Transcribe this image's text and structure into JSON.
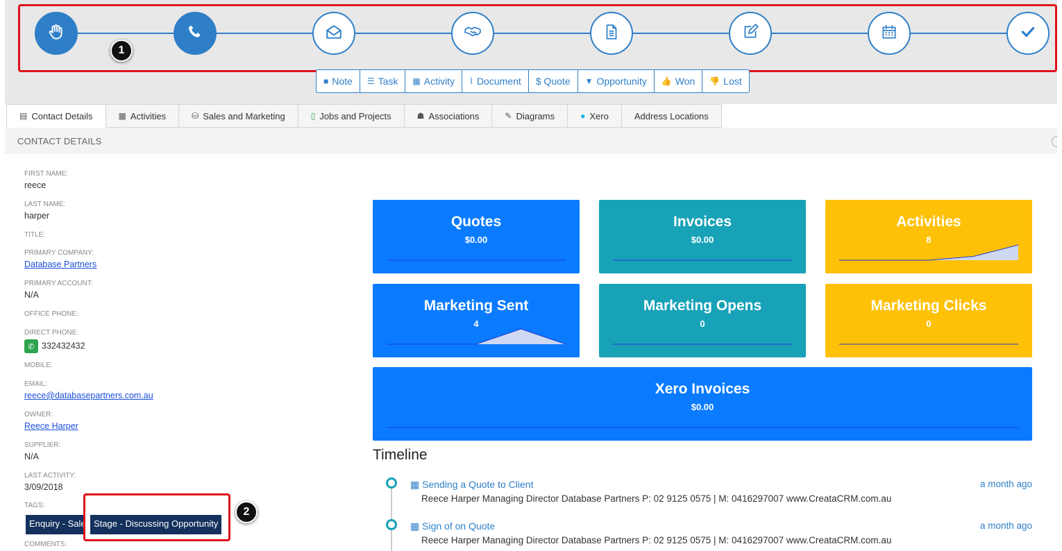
{
  "pipeline": {
    "stages": [
      {
        "icon": "hand-icon",
        "done": true
      },
      {
        "icon": "phone-icon",
        "done": true
      },
      {
        "icon": "envelope-open-icon",
        "done": false
      },
      {
        "icon": "handshake-icon",
        "done": false
      },
      {
        "icon": "document-icon",
        "done": false
      },
      {
        "icon": "edit-icon",
        "done": false
      },
      {
        "icon": "calendar-icon",
        "done": false
      },
      {
        "icon": "checkmark-icon",
        "done": false
      }
    ],
    "accent": "#2f7fc8"
  },
  "annotations": {
    "marker1": "1",
    "marker2": "2"
  },
  "actions": [
    {
      "icon": "sticky-note-icon",
      "label": "Note"
    },
    {
      "icon": "task-list-icon",
      "label": "Task"
    },
    {
      "icon": "calendar-icon",
      "label": "Activity"
    },
    {
      "icon": "paperclip-icon",
      "label": "Document"
    },
    {
      "icon": "dollar-icon",
      "label": "$ Quote"
    },
    {
      "icon": "filter-icon",
      "label": "Opportunity"
    },
    {
      "icon": "thumbs-up-icon",
      "label": "Won"
    },
    {
      "icon": "thumbs-down-icon",
      "label": "Lost"
    }
  ],
  "tabs": [
    {
      "icon": "id-card-icon",
      "label": "Contact Details"
    },
    {
      "icon": "calendar-icon",
      "label": "Activities"
    },
    {
      "icon": "coins-icon",
      "label": "Sales and Marketing"
    },
    {
      "icon": "file-icon",
      "label": "Jobs and Projects"
    },
    {
      "icon": "sitemap-icon",
      "label": "Associations"
    },
    {
      "icon": "pencil-icon",
      "label": "Diagrams"
    },
    {
      "icon": "xero-icon",
      "label": "Xero"
    },
    {
      "icon": "",
      "label": "Address Locations"
    }
  ],
  "section": {
    "title": "CONTACT DETAILS"
  },
  "contact": {
    "first_name_label": "FIRST NAME:",
    "first_name": "reece",
    "last_name_label": "LAST NAME:",
    "last_name": "harper",
    "title_label": "TITLE:",
    "company_label": "PRIMARY COMPANY:",
    "company": "Database Partners",
    "account_label": "PRIMARY ACCOUNT:",
    "account": "N/A",
    "office_phone_label": "OFFICE PHONE:",
    "direct_phone_label": "DIRECT PHONE:",
    "direct_phone": "332432432",
    "mobile_label": "MOBILE:",
    "email_label": "EMAIL:",
    "email": "reece@databasepartners.com.au",
    "owner_label": "OWNER:",
    "owner": "Reece Harper",
    "supplier_label": "SUPPLIER:",
    "supplier": "N/A",
    "last_activity_label": "LAST ACTIVITY:",
    "last_activity": "3/09/2018",
    "tags_label": "TAGS:",
    "tags": [
      "Enquiry - Sales",
      "Stage - Discussing Opportunity"
    ],
    "comments_label": "COMMENTS:"
  },
  "cards": [
    {
      "title": "Quotes",
      "value": "$0.00",
      "trend": [
        0,
        0,
        0,
        0,
        0
      ]
    },
    {
      "title": "Invoices",
      "value": "$0.00",
      "trend": [
        0,
        0,
        0,
        0,
        0
      ]
    },
    {
      "title": "Activities",
      "value": "8",
      "trend": [
        0,
        0,
        0,
        2,
        8
      ]
    },
    {
      "title": "Marketing Sent",
      "value": "4",
      "trend": [
        0,
        0,
        0,
        4,
        0
      ]
    },
    {
      "title": "Marketing Opens",
      "value": "0",
      "trend": [
        0,
        0,
        0,
        0,
        0
      ]
    },
    {
      "title": "Marketing Clicks",
      "value": "0",
      "trend": [
        0,
        0,
        0,
        0,
        0
      ]
    },
    {
      "title": "Xero Invoices",
      "value": "$0.00",
      "trend": [
        0,
        0,
        0,
        0,
        0
      ]
    }
  ],
  "timeline": {
    "title": "Timeline",
    "items": [
      {
        "title": "Sending a Quote to Client",
        "time": "a month ago",
        "body": "Reece Harper  Managing Director  Database Partners  P: 02 9125 0575 |  M: 0416297007  www.CreataCRM.com.au"
      },
      {
        "title": "Sign of on Quote",
        "time": "a month ago",
        "body": "Reece Harper  Managing Director  Database Partners  P: 02 9125 0575 |  M: 0416297007  www.CreataCRM.com.au"
      }
    ]
  },
  "colors": {
    "blue": "#0a7bff",
    "teal": "#17a2b8",
    "yellow": "#ffc107",
    "tag": "#13315c",
    "highlight": "#e0111b"
  }
}
